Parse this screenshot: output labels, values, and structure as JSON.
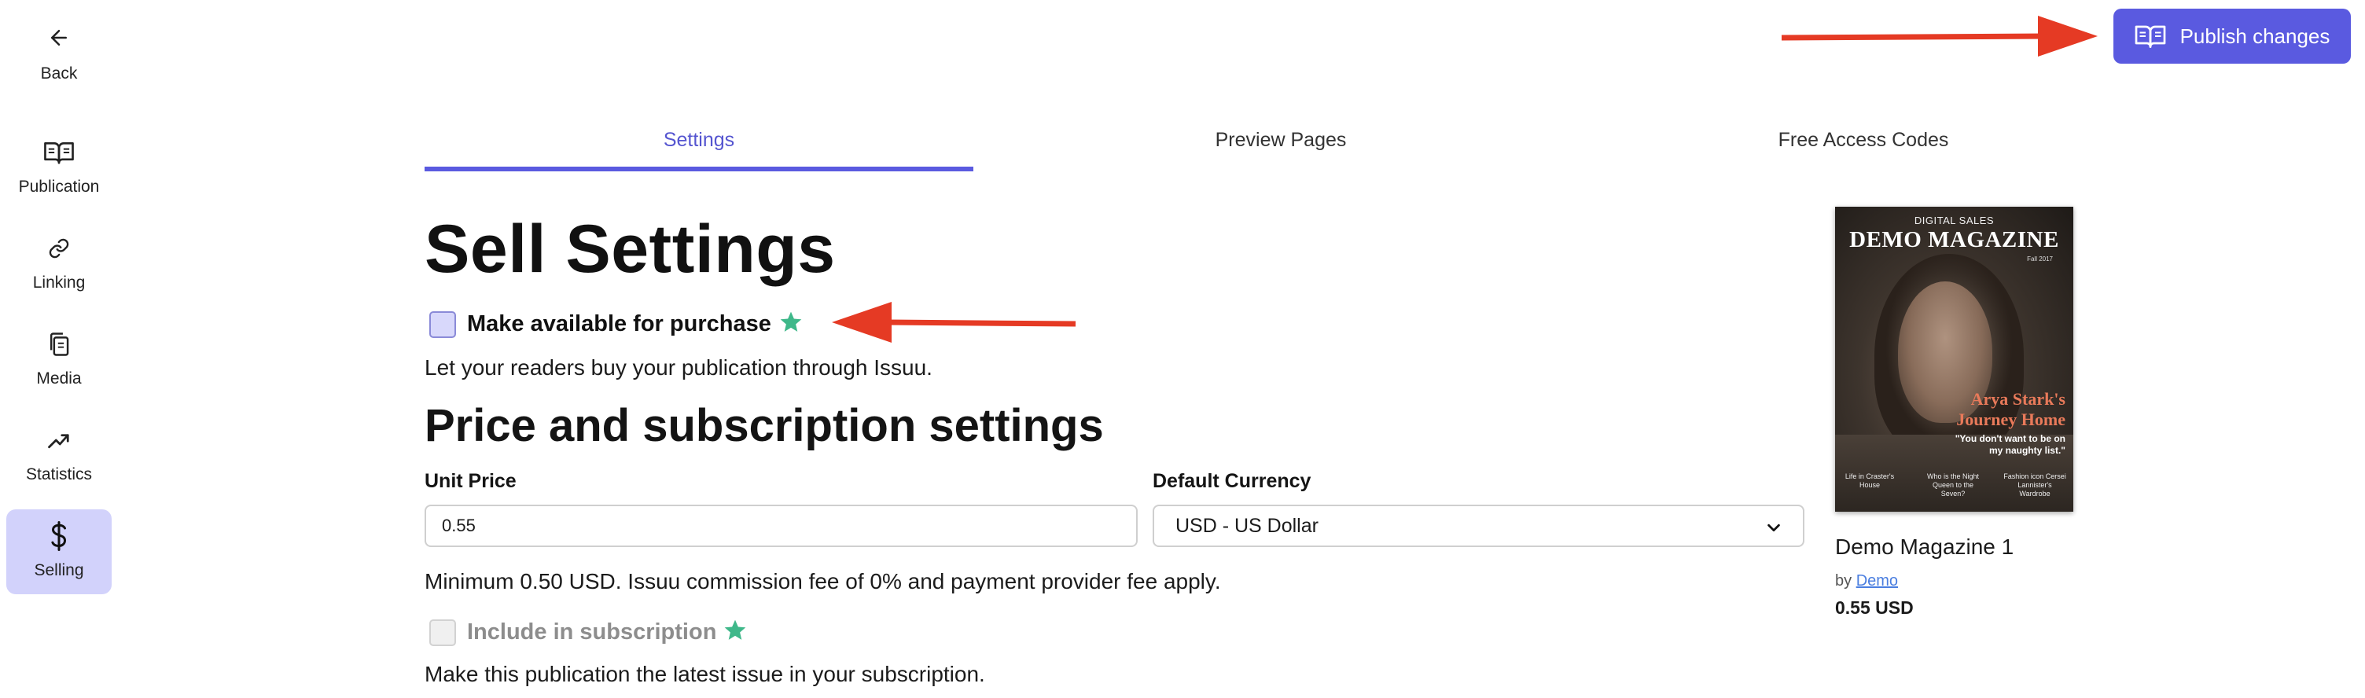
{
  "sidebar": {
    "back_label": "Back",
    "items": [
      {
        "label": "Publication",
        "icon": "book-open-icon"
      },
      {
        "label": "Linking",
        "icon": "link-icon"
      },
      {
        "label": "Media",
        "icon": "copy-icon"
      },
      {
        "label": "Statistics",
        "icon": "trending-up-icon"
      },
      {
        "label": "Selling",
        "icon": "dollar-icon",
        "active": true
      }
    ]
  },
  "header": {
    "publish_label": "Publish changes"
  },
  "tabs": [
    {
      "label": "Settings",
      "active": true
    },
    {
      "label": "Preview Pages"
    },
    {
      "label": "Free Access Codes"
    }
  ],
  "main": {
    "title": "Sell Settings",
    "purchase_checkbox_label": "Make available for purchase",
    "purchase_description": "Let your readers buy your publication through Issuu.",
    "price_section_title": "Price and subscription settings",
    "unit_price_label": "Unit Price",
    "unit_price_value": "0.55",
    "currency_label": "Default Currency",
    "currency_value": "USD - US Dollar",
    "fee_note": "Minimum 0.50 USD. Issuu commission fee of 0% and payment provider fee apply.",
    "subscription_checkbox_label": "Include in subscription",
    "subscription_description": "Make this publication the latest issue in your subscription."
  },
  "publication_card": {
    "cover_kicker": "DIGITAL SALES",
    "cover_title": "DEMO MAGAZINE",
    "cover_date": "Fall 2017",
    "cover_headline": "Arya Stark's Journey Home",
    "cover_quote": "\"You don't want to be on my naughty list.\"",
    "cover_tease_left": "Life in Craster's House",
    "cover_tease_mid": "Who is the Night Queen to the Seven?",
    "cover_tease_right": "Fashion icon Cersei Lannister's Wardrobe",
    "title": "Demo Magazine 1",
    "by_prefix": "by",
    "author": "Demo",
    "price": "0.55 USD"
  },
  "colors": {
    "accent": "#5a5ae0",
    "active_sidebar_bg": "#d2d2fb",
    "star": "#3fb88a",
    "annotation_arrow": "#e53a24"
  }
}
